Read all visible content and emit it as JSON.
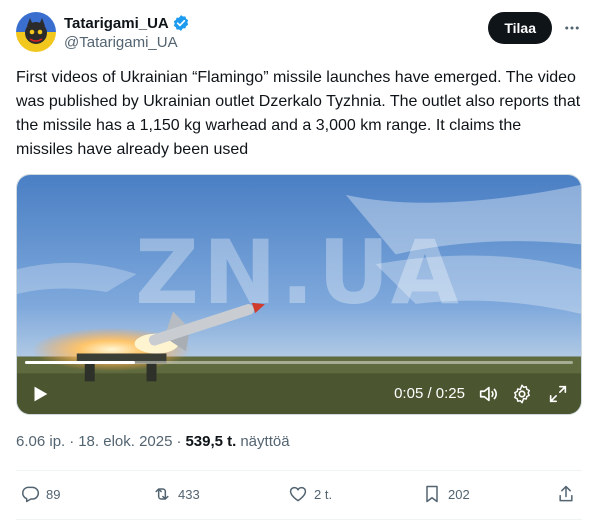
{
  "author": {
    "display_name": "Tatarigami_UA",
    "handle": "@Tatarigami_UA",
    "verified_icon": "verified-badge-icon",
    "avatar_icon": "avatar-cat-emblem"
  },
  "subscribe_label": "Tilaa",
  "tweet": {
    "text": "First videos of Ukrainian “Flamingo” missile launches have emerged. The video was published by Ukrainian outlet Dzerkalo Tyzhnia. The outlet also reports that the missile has a 1,150 kg warhead and a 3,000 km range. It claims the missiles have already been used"
  },
  "video": {
    "watermark": "ZN.UA",
    "time": "0:05 / 0:25",
    "progress": 0.2
  },
  "meta": {
    "time": "6.06 ip.",
    "sep1": "·",
    "date": "18. elok. 2025",
    "sep2": "·",
    "views": "539,5 t.",
    "views_label": "näyttöä"
  },
  "actions": {
    "replies": "89",
    "reposts": "433",
    "likes": "2 t.",
    "bookmarks": "202"
  },
  "colors": {
    "accent": "#1d9bf0",
    "text": "#0f1419",
    "muted": "#536471"
  }
}
